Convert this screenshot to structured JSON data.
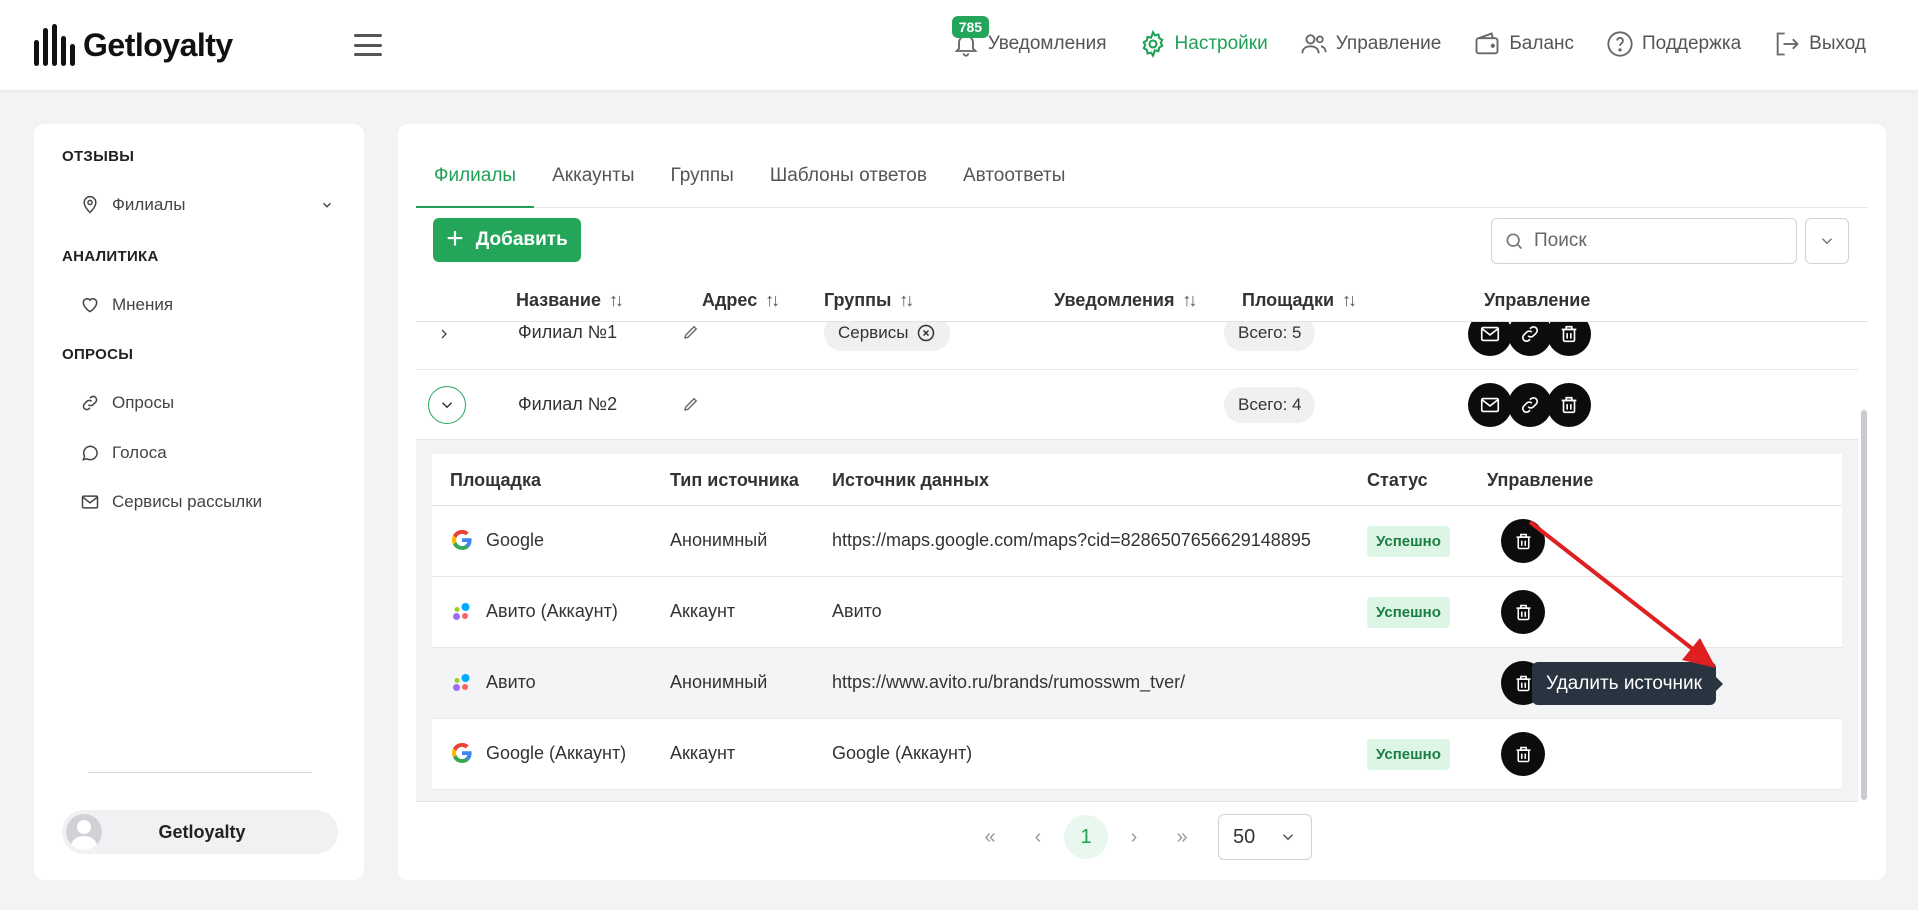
{
  "header": {
    "logo_text": "Getloyalty",
    "nav": [
      {
        "label": "Уведомления",
        "badge": "785",
        "icon": "bell-icon"
      },
      {
        "label": "Настройки",
        "icon": "gear-icon",
        "active": true
      },
      {
        "label": "Управление",
        "icon": "users-icon"
      },
      {
        "label": "Баланс",
        "icon": "wallet-icon"
      },
      {
        "label": "Поддержка",
        "icon": "help-icon"
      },
      {
        "label": "Выход",
        "icon": "logout-icon"
      }
    ]
  },
  "sidebar": {
    "sections": [
      {
        "title": "ОТЗЫВЫ",
        "items": [
          {
            "label": "Филиалы",
            "icon": "location-pin-icon",
            "has_chevron": true
          }
        ]
      },
      {
        "title": "АНАЛИТИКА",
        "items": [
          {
            "label": "Мнения",
            "icon": "heart-icon"
          }
        ]
      },
      {
        "title": "ОПРОСЫ",
        "items": [
          {
            "label": "Опросы",
            "icon": "link-icon"
          },
          {
            "label": "Голоса",
            "icon": "chat-bubble-icon"
          },
          {
            "label": "Сервисы рассылки",
            "icon": "mail-icon"
          }
        ]
      }
    ],
    "user_name": "Getloyalty"
  },
  "tabs": [
    "Филиалы",
    "Аккаунты",
    "Группы",
    "Шаблоны ответов",
    "Автоответы"
  ],
  "toolbar": {
    "add_label": "Добавить",
    "search_placeholder": "Поиск"
  },
  "table": {
    "columns": [
      "Название",
      "Адрес",
      "Группы",
      "Уведомления",
      "Площадки",
      "Управление"
    ],
    "rows": [
      {
        "name": "Филиал №1",
        "group": "Сервисы",
        "platforms": "Всего: 5"
      },
      {
        "name": "Филиал №2",
        "group": "",
        "platforms": "Всего: 4"
      }
    ]
  },
  "subtable": {
    "columns": [
      "Площадка",
      "Тип источника",
      "Источник данных",
      "Статус",
      "Управление"
    ],
    "rows": [
      {
        "platform": "Google",
        "icon": "google-icon",
        "type": "Анонимный",
        "source": "https://maps.google.com/maps?cid=8286507656629148895",
        "status": "Успешно"
      },
      {
        "platform": "Авито (Аккаунт)",
        "icon": "avito-icon",
        "type": "Аккаунт",
        "source": "Авито",
        "status": "Успешно"
      },
      {
        "platform": "Авито",
        "icon": "avito-icon",
        "type": "Анонимный",
        "source": "https://www.avito.ru/brands/rumosswm_tver/",
        "status": ""
      },
      {
        "platform": "Google (Аккаунт)",
        "icon": "google-icon",
        "type": "Аккаунт",
        "source": "Google (Аккаунт)",
        "status": "Успешно"
      }
    ]
  },
  "tooltip": "Удалить источник",
  "pagination": {
    "first": "«",
    "prev": "‹",
    "current": "1",
    "next": "›",
    "last": "»",
    "per_page": "50"
  },
  "colors": {
    "accent": "#23a65a",
    "status_bg": "#dcf5e4",
    "arrow": "#e02020"
  }
}
